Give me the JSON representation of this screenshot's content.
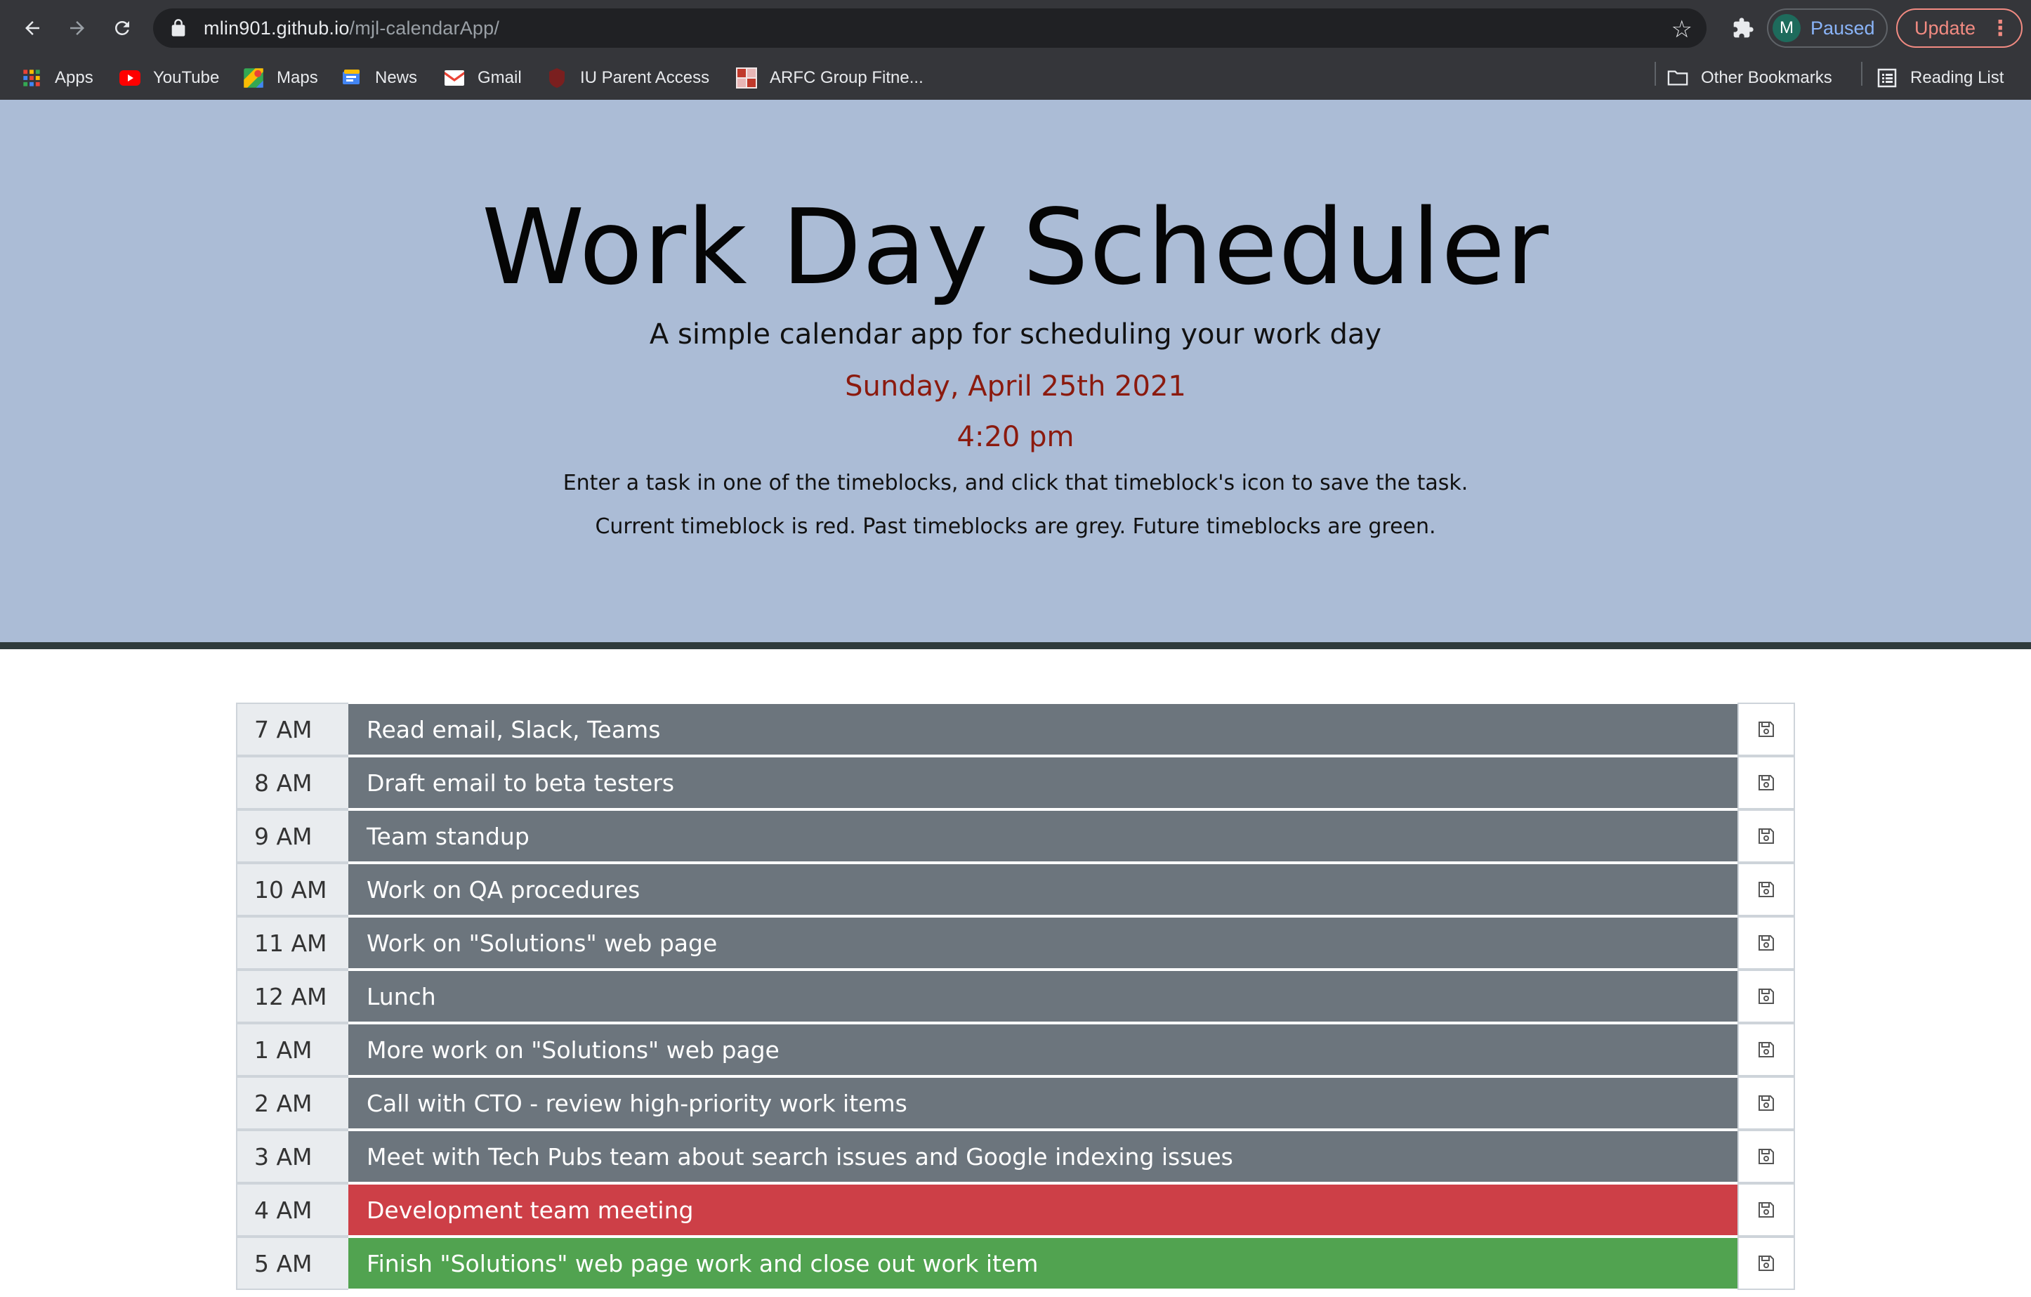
{
  "browser": {
    "url_host": "mlin901.github.io",
    "url_path": "/mjl-calendarApp/",
    "profile_initial": "M",
    "profile_status": "Paused",
    "update_label": "Update",
    "bookmarks": [
      {
        "label": "Apps",
        "icon": "apps-grid-icon"
      },
      {
        "label": "YouTube",
        "icon": "youtube-icon"
      },
      {
        "label": "Maps",
        "icon": "maps-icon"
      },
      {
        "label": "News",
        "icon": "news-icon"
      },
      {
        "label": "Gmail",
        "icon": "gmail-icon"
      },
      {
        "label": "IU Parent Access",
        "icon": "iu-icon"
      },
      {
        "label": "ARFC Group Fitne...",
        "icon": "arfc-icon"
      }
    ],
    "other_bookmarks": "Other Bookmarks",
    "reading_list": "Reading List"
  },
  "header": {
    "title": "Work Day Scheduler",
    "lead": "A simple calendar app for scheduling your work day",
    "date": "Sunday, April 25th 2021",
    "time": "4:20 pm",
    "instruction1": "Enter a task in one of the timeblocks, and click that timeblock's icon to save the task.",
    "instruction2": "Current timeblock is red. Past timeblocks are grey. Future timeblocks are green."
  },
  "colors": {
    "past": "#6c757d",
    "present": "#cd3f47",
    "future": "#51a350",
    "jumbotron": "#abbcd6"
  },
  "timeblocks": [
    {
      "hour": "7 AM",
      "task": "Read email, Slack, Teams",
      "state": "past"
    },
    {
      "hour": "8 AM",
      "task": "Draft email to beta testers",
      "state": "past"
    },
    {
      "hour": "9 AM",
      "task": "Team standup",
      "state": "past"
    },
    {
      "hour": "10 AM",
      "task": "Work on QA procedures",
      "state": "past"
    },
    {
      "hour": "11 AM",
      "task": "Work on \"Solutions\" web page",
      "state": "past"
    },
    {
      "hour": "12 AM",
      "task": "Lunch",
      "state": "past"
    },
    {
      "hour": "1 AM",
      "task": "More work on \"Solutions\" web page",
      "state": "past"
    },
    {
      "hour": "2 AM",
      "task": "Call with CTO - review high-priority work items",
      "state": "past"
    },
    {
      "hour": "3 AM",
      "task": "Meet with Tech Pubs team about search issues and Google indexing issues",
      "state": "past"
    },
    {
      "hour": "4 AM",
      "task": "Development team meeting",
      "state": "present"
    },
    {
      "hour": "5 AM",
      "task": "Finish \"Solutions\" web page work and close out work item",
      "state": "future"
    }
  ]
}
